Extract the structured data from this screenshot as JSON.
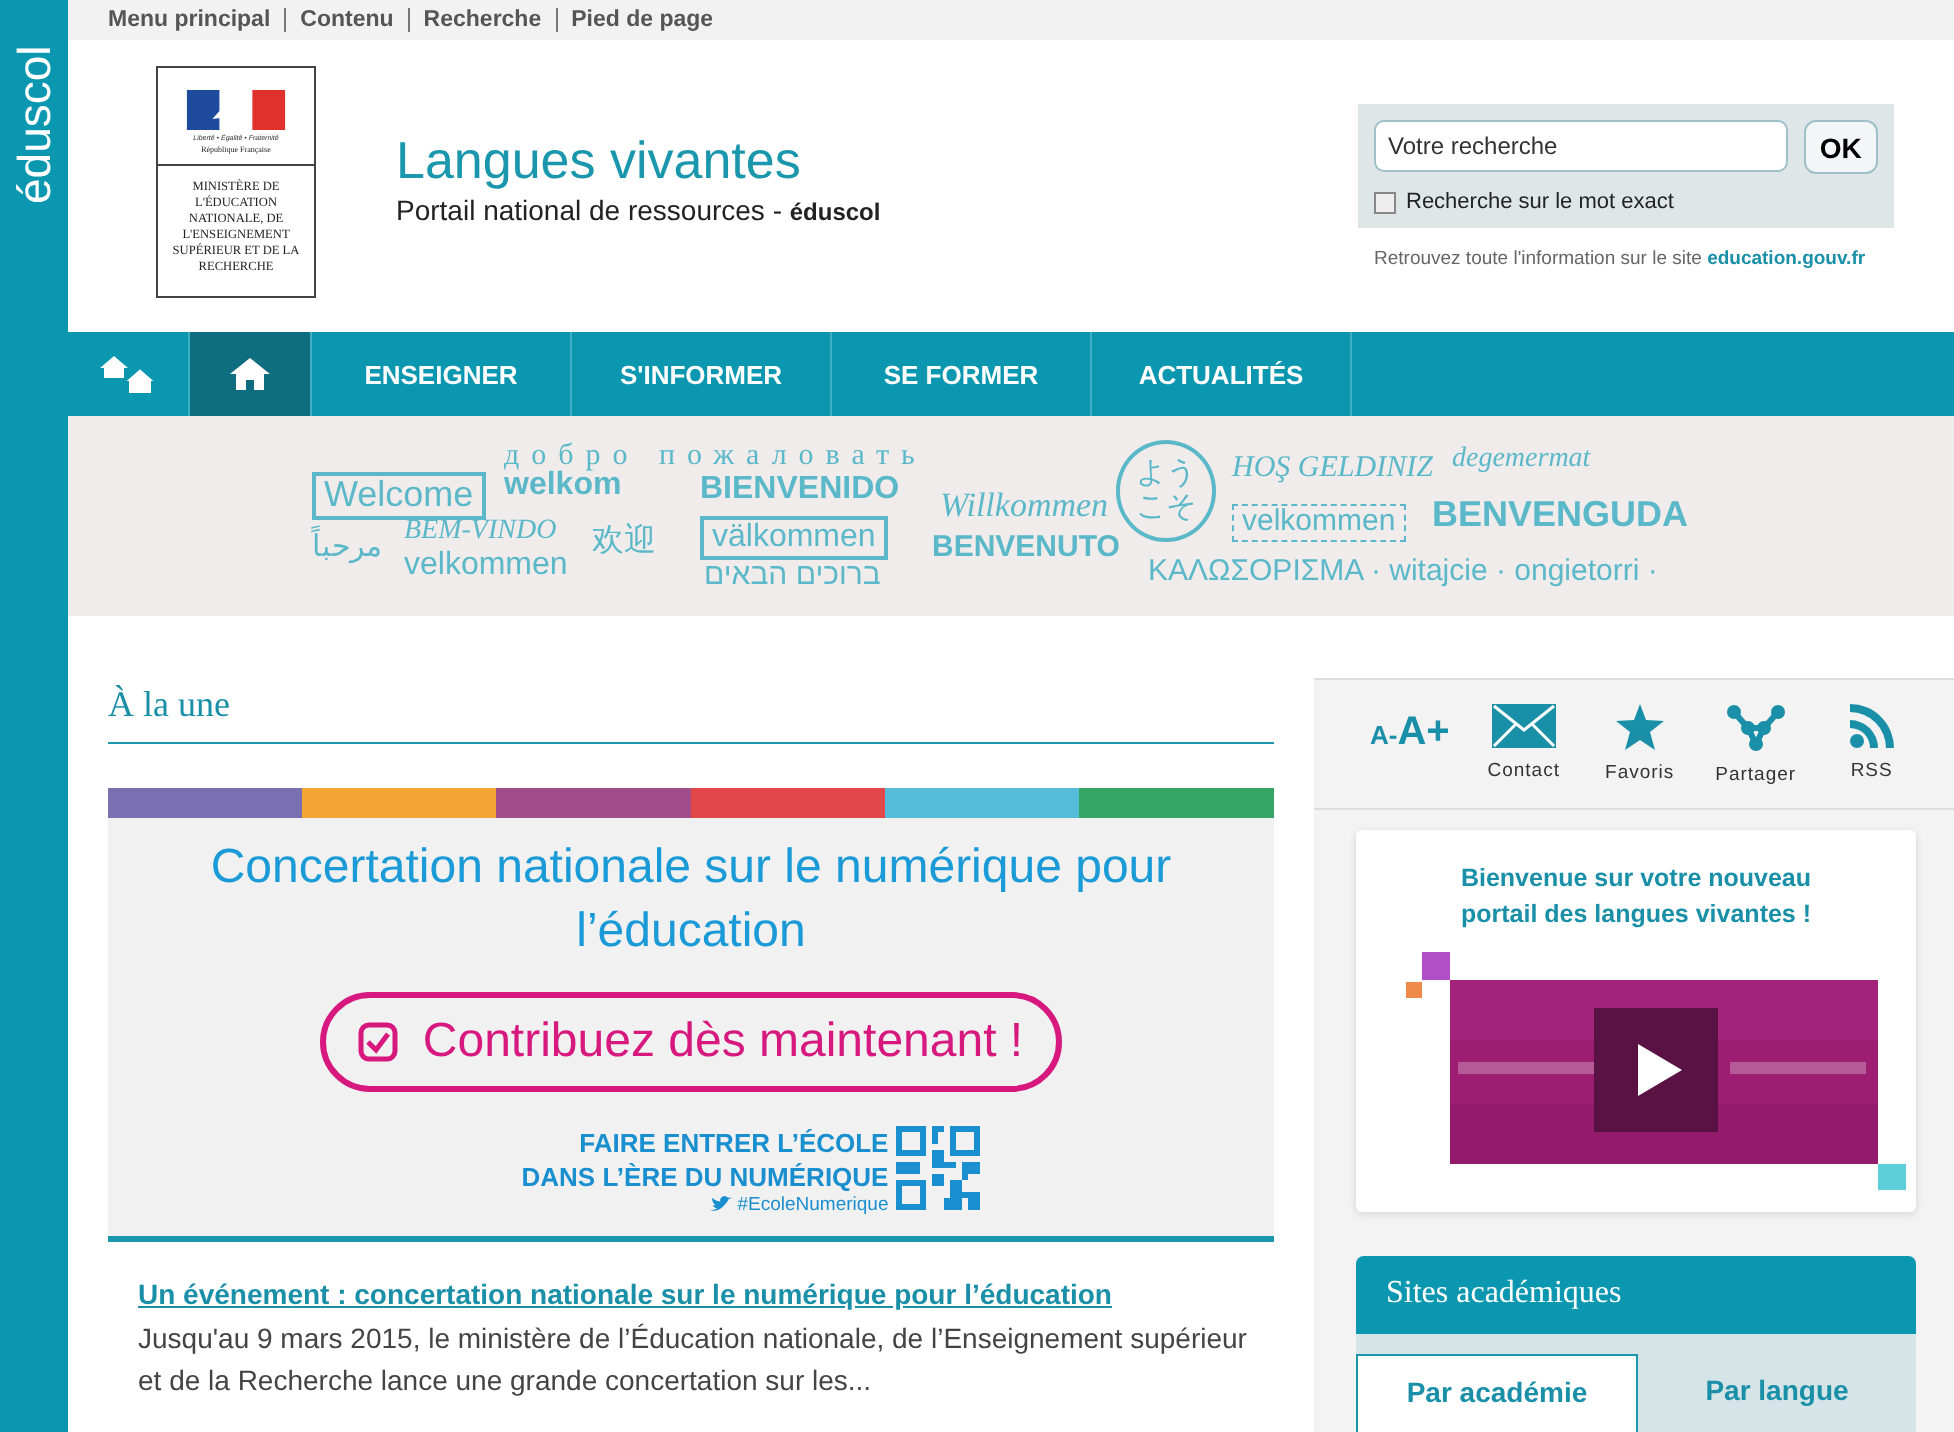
{
  "side_logo": {
    "text": "éduscol"
  },
  "skip_links": [
    "Menu principal",
    "Contenu",
    "Recherche",
    "Pied de page"
  ],
  "header": {
    "ministry_logo": {
      "motto": "Liberté • Égalité • Fraternité",
      "republic": "République Française",
      "ministry": "MINISTÈRE DE L'ÉDUCATION NATIONALE, DE L'ENSEIGNEMENT SUPÉRIEUR ET DE LA RECHERCHE"
    },
    "title": "Langues vivantes",
    "subtitle": "Portail national de ressources - ",
    "subtitle_brand": "éduscol"
  },
  "search": {
    "placeholder": "Votre recherche",
    "button": "OK",
    "exact_label": "Recherche sur le mot exact",
    "exact_checked": false,
    "note": "Retrouvez toute l'information sur le site ",
    "note_link": "education.gouv.fr"
  },
  "nav": [
    {
      "kind": "home-pair",
      "selected": false
    },
    {
      "kind": "home",
      "selected": true
    },
    {
      "kind": "text",
      "label": "ENSEIGNER",
      "selected": false
    },
    {
      "kind": "text",
      "label": "S'INFORMER",
      "selected": false
    },
    {
      "kind": "text",
      "label": "SE FORMER",
      "selected": false
    },
    {
      "kind": "text",
      "label": "ACTUALITÉS",
      "selected": false
    }
  ],
  "welcome_banner": [
    {
      "text": "Welcome",
      "kind": "boxed"
    },
    {
      "text": "добро пожаловать",
      "kind": "spaced"
    },
    {
      "text": "welkom",
      "kind": "bold"
    },
    {
      "text": "BIENVENIDO",
      "kind": "bold"
    },
    {
      "text": "Willkommen",
      "kind": "script"
    },
    {
      "text": "ようこそ",
      "kind": "circle"
    },
    {
      "text": "HOŞ GELDINIZ",
      "kind": "script"
    },
    {
      "text": "degemermat",
      "kind": "script"
    },
    {
      "text": "مرحباً",
      "kind": "plain"
    },
    {
      "text": "BEM-VINDO",
      "kind": "script"
    },
    {
      "text": "velkommen",
      "kind": "plain"
    },
    {
      "text": "欢迎",
      "kind": "plain"
    },
    {
      "text": "välkommen",
      "kind": "boxed"
    },
    {
      "text": "ברוכים הבאים",
      "kind": "plain"
    },
    {
      "text": "BENVENUTO",
      "kind": "bold"
    },
    {
      "text": "velkommen",
      "kind": "dashed"
    },
    {
      "text": "BENVENGUDA",
      "kind": "bold"
    },
    {
      "text": "ΚΑΛΩΣΟΡΙΣΜΑ · witajcie · ongietorri ·",
      "kind": "plain"
    }
  ],
  "main": {
    "heading": "À la une",
    "feature": {
      "title": "Concertation nationale sur le numérique pour l’éducation",
      "cta": "Contribuez dès maintenant !",
      "slogan_1": "FAIRE ENTRER L’ÉCOLE",
      "slogan_2": "DANS L’ÈRE DU NUMÉRIQUE",
      "hashtag": "#EcoleNumerique"
    },
    "article": {
      "link": "Un événement : concertation nationale sur le numérique pour l’éducation",
      "text": "Jusqu'au 9 mars 2015, le ministère de l’Éducation nationale, de l’Enseignement supérieur et de la Recherche lance une grande concertation sur les..."
    }
  },
  "tools": {
    "font_smaller": "A-",
    "font_larger": "A+",
    "items": [
      {
        "kind": "mail",
        "label": "Contact"
      },
      {
        "kind": "star",
        "label": "Favoris"
      },
      {
        "kind": "share",
        "label": "Partager"
      },
      {
        "kind": "rss",
        "label": "RSS"
      }
    ]
  },
  "welcome_card": {
    "title": "Bienvenue sur votre nouveau portail des langues vivantes !"
  },
  "sites": {
    "title": "Sites académiques",
    "tabs": [
      {
        "label": "Par académie",
        "selected": true
      },
      {
        "label": "Par langue",
        "selected": false
      }
    ]
  }
}
